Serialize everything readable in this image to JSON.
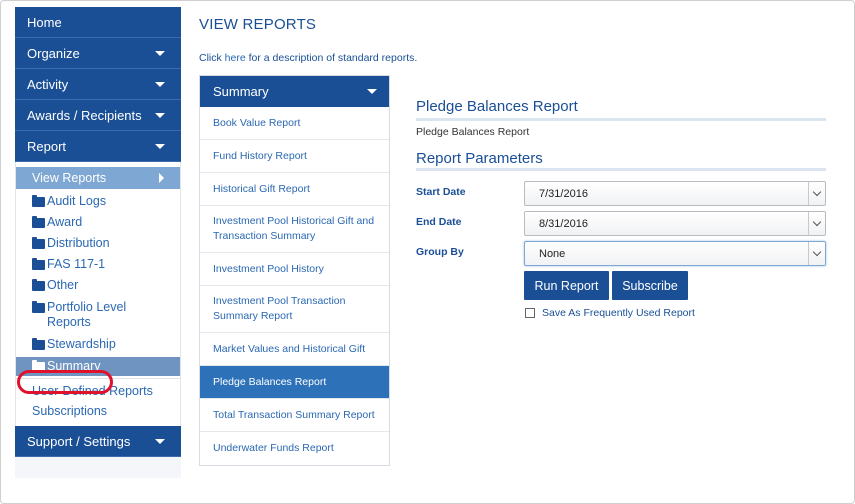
{
  "sidebar": {
    "nav": {
      "home": "Home",
      "organize": "Organize",
      "activity": "Activity",
      "awards": "Awards / Recipients",
      "report": "Report",
      "support": "Support / Settings"
    },
    "view_reports": "View Reports",
    "folders": [
      "Audit Logs",
      "Award",
      "Distribution",
      "FAS 117-1",
      "Other",
      "Portfolio Level Reports",
      "Stewardship",
      "Summary"
    ],
    "user_defined": "User-Defined Reports",
    "subscriptions": "Subscriptions"
  },
  "main": {
    "title": "VIEW REPORTS",
    "intro_prefix": "Click ",
    "intro_link": "here",
    "intro_suffix": " for a description of standard reports."
  },
  "report_list": {
    "header": "Summary",
    "items": [
      "Book Value Report",
      "Fund History Report",
      "Historical Gift Report",
      "Investment Pool Historical Gift and Transaction Summary",
      "Investment Pool History",
      "Investment Pool Transaction Summary Report",
      "Market Values and Historical Gift",
      "Pledge Balances Report",
      "Total Transaction Summary Report",
      "Underwater Funds Report"
    ],
    "selected": "Pledge Balances Report"
  },
  "report_panel": {
    "title": "Pledge Balances Report",
    "subtitle": "Pledge Balances Report",
    "params_title": "Report Parameters",
    "start_label": "Start Date",
    "start_value": "7/31/2016",
    "end_label": "End Date",
    "end_value": "8/31/2016",
    "group_label": "Group By",
    "group_value": "None",
    "run_button": "Run Report",
    "subscribe_button": "Subscribe",
    "save_label": "Save As Frequently Used Report"
  },
  "colors": {
    "nav_blue": "#1a4f96",
    "link_blue": "#2a68b3",
    "highlight_red": "#e0112b"
  }
}
